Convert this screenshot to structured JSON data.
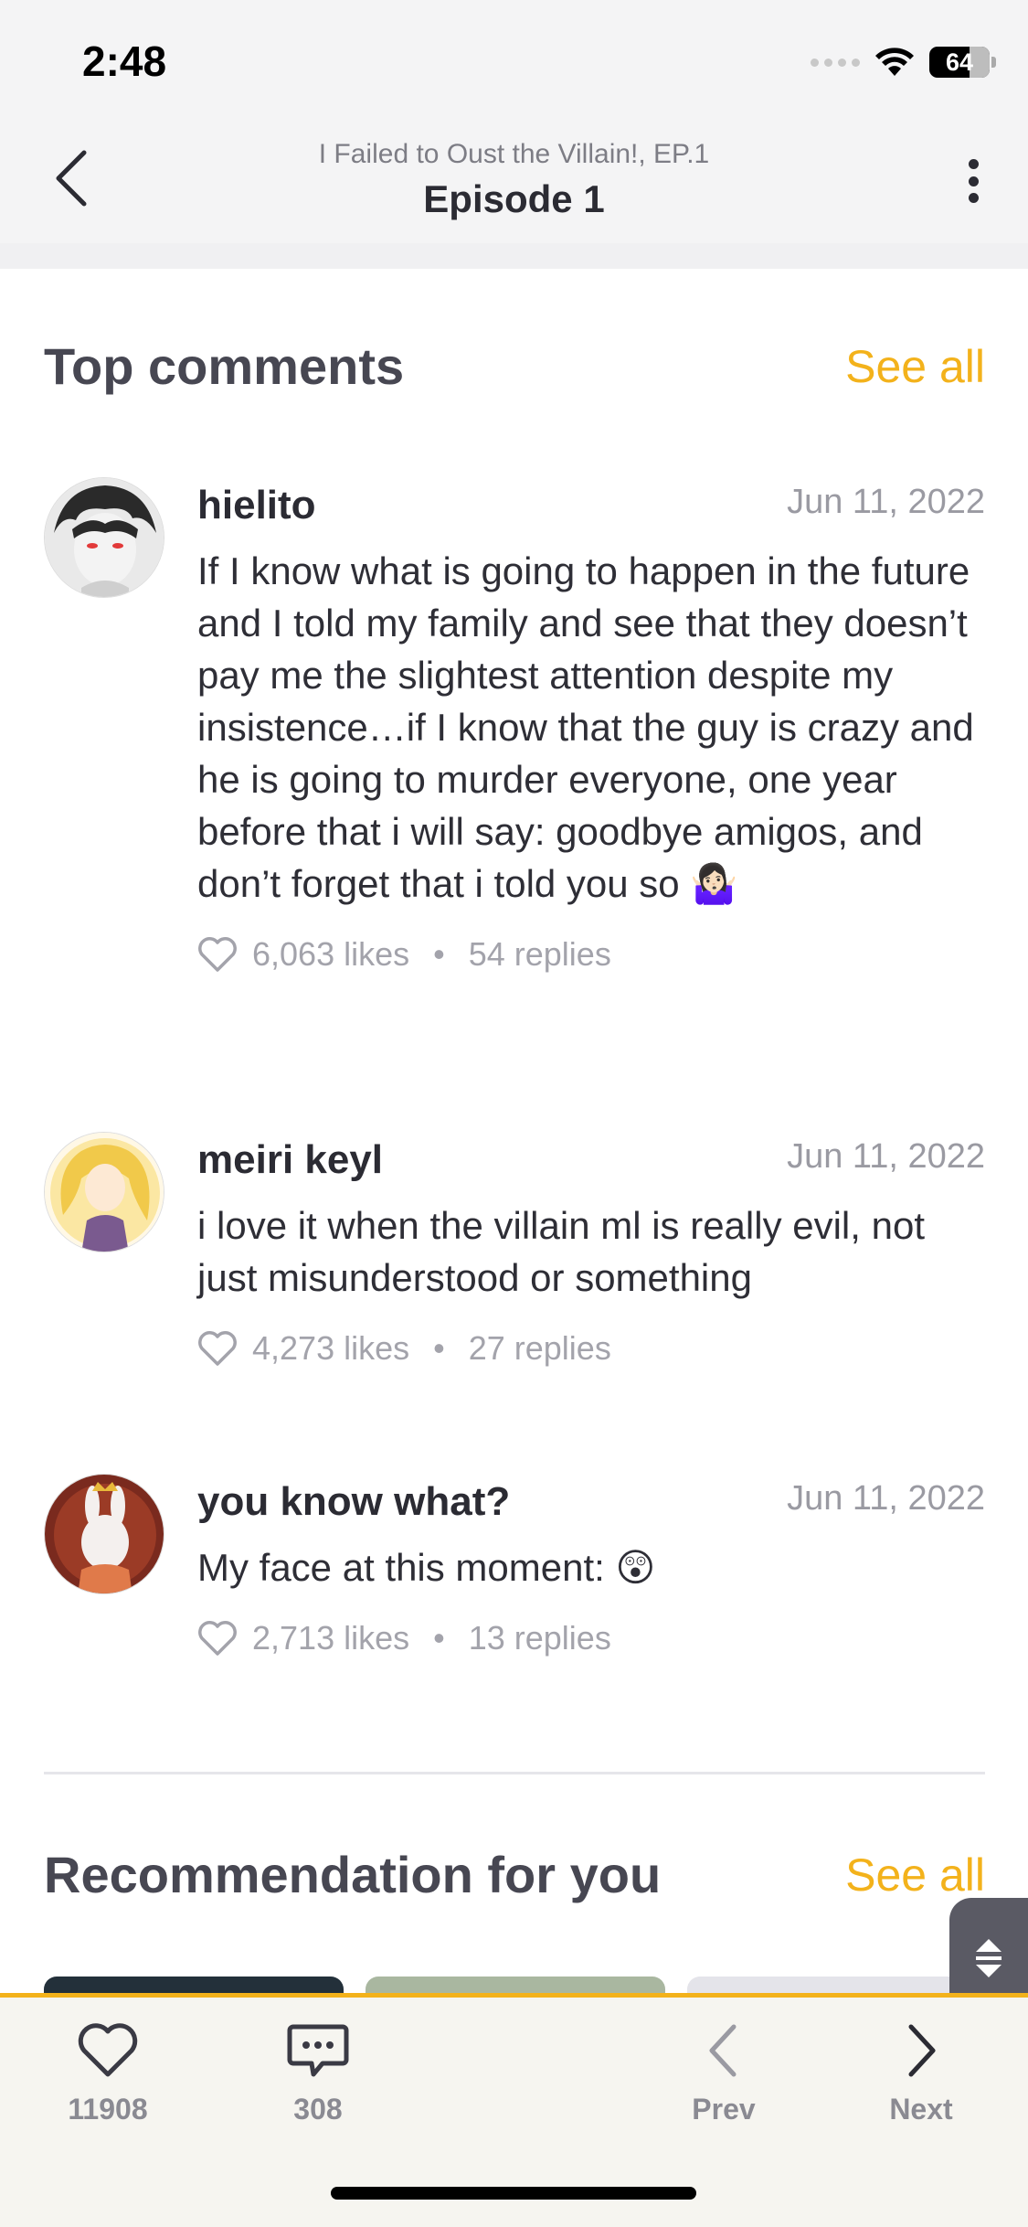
{
  "status_bar": {
    "time": "2:48",
    "battery": "64"
  },
  "header": {
    "subtitle": "I Failed to Oust the Villain!, EP.1",
    "title": "Episode 1"
  },
  "top_comments": {
    "title": "Top comments",
    "see_all": "See all",
    "comments": [
      {
        "author": "hielito",
        "date": "Jun 11, 2022",
        "text": "If I know what is going to happen in the future and I told my family and see that they doesn’t pay me the slightest attention despite my insistence…if I know that the guy is crazy and he is going to murder everyone, one year before that i will say: goodbye amigos, and don’t forget that i told you so 🤷🏻‍♀️",
        "likes": "6,063 likes",
        "replies": "54 replies"
      },
      {
        "author": "meiri keyl",
        "date": "Jun 11, 2022",
        "text": "i love it when the villain ml is really evil, not just misunderstood or something",
        "likes": "4,273 likes",
        "replies": "27 replies"
      },
      {
        "author": "you know what?",
        "date": "Jun 11, 2022",
        "text": "My face at this moment: 😲",
        "likes": "2,713 likes",
        "replies": "13 replies"
      }
    ]
  },
  "recommendation": {
    "title": "Recommendation for you",
    "see_all": "See all"
  },
  "bottom_bar": {
    "like_count": "11908",
    "comment_count": "308",
    "prev": "Prev",
    "next": "Next"
  },
  "colors": {
    "accent": "#f3b21b",
    "muted": "#a3a3ab"
  }
}
